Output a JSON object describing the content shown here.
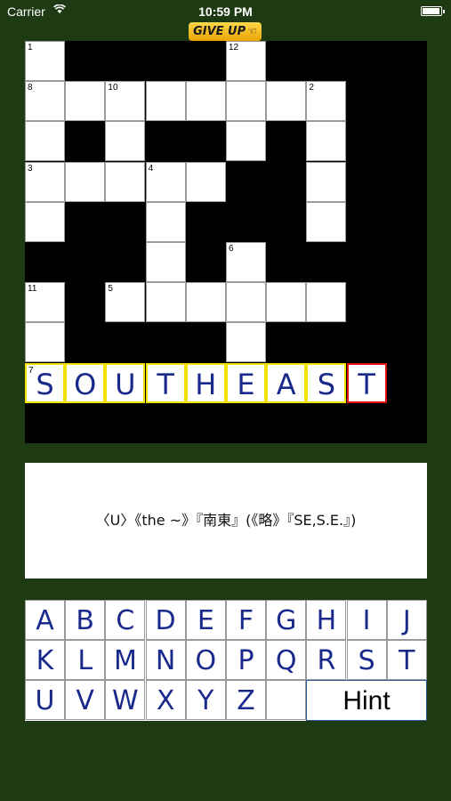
{
  "status": {
    "carrier": "Carrier",
    "time": "10:59 PM"
  },
  "header": {
    "give_up_label": "GIVE UP"
  },
  "board": {
    "cells": [
      {
        "r": 0,
        "c": 0,
        "num": "1"
      },
      {
        "r": 0,
        "c": 5,
        "num": "12"
      },
      {
        "r": 1,
        "c": 0,
        "num": "8"
      },
      {
        "r": 1,
        "c": 1
      },
      {
        "r": 1,
        "c": 2,
        "num": "10"
      },
      {
        "r": 1,
        "c": 3
      },
      {
        "r": 1,
        "c": 4
      },
      {
        "r": 1,
        "c": 5
      },
      {
        "r": 1,
        "c": 6
      },
      {
        "r": 1,
        "c": 7,
        "num": "2"
      },
      {
        "r": 2,
        "c": 0
      },
      {
        "r": 2,
        "c": 2
      },
      {
        "r": 2,
        "c": 5
      },
      {
        "r": 2,
        "c": 7
      },
      {
        "r": 3,
        "c": 0,
        "num": "3"
      },
      {
        "r": 3,
        "c": 1
      },
      {
        "r": 3,
        "c": 2
      },
      {
        "r": 3,
        "c": 3,
        "num": "4"
      },
      {
        "r": 3,
        "c": 4
      },
      {
        "r": 3,
        "c": 7
      },
      {
        "r": 4,
        "c": 0
      },
      {
        "r": 4,
        "c": 3
      },
      {
        "r": 4,
        "c": 7
      },
      {
        "r": 5,
        "c": 3
      },
      {
        "r": 5,
        "c": 5,
        "num": "6"
      },
      {
        "r": 6,
        "c": 0,
        "num": "11"
      },
      {
        "r": 6,
        "c": 2,
        "num": "5"
      },
      {
        "r": 6,
        "c": 3
      },
      {
        "r": 6,
        "c": 4
      },
      {
        "r": 6,
        "c": 5
      },
      {
        "r": 6,
        "c": 6
      },
      {
        "r": 6,
        "c": 7
      },
      {
        "r": 7,
        "c": 0
      },
      {
        "r": 7,
        "c": 5
      },
      {
        "r": 8,
        "c": 0,
        "num": "7",
        "letter": "S",
        "state": "active"
      },
      {
        "r": 8,
        "c": 1,
        "letter": "O",
        "state": "active"
      },
      {
        "r": 8,
        "c": 2,
        "letter": "U",
        "state": "active"
      },
      {
        "r": 8,
        "c": 3,
        "letter": "T",
        "state": "active"
      },
      {
        "r": 8,
        "c": 4,
        "letter": "H",
        "state": "active"
      },
      {
        "r": 8,
        "c": 5,
        "letter": "E",
        "state": "active"
      },
      {
        "r": 8,
        "c": 6,
        "letter": "A",
        "state": "active"
      },
      {
        "r": 8,
        "c": 7,
        "letter": "S",
        "state": "active"
      },
      {
        "r": 8,
        "c": 8,
        "letter": "T",
        "state": "current"
      }
    ]
  },
  "clue": {
    "text": "〈U〉《the ~》『南東』(《略》『SE,S.E.』)"
  },
  "keyboard": {
    "rows": [
      [
        "A",
        "B",
        "C",
        "D",
        "E",
        "F",
        "G",
        "H",
        "I",
        "J"
      ],
      [
        "K",
        "L",
        "M",
        "N",
        "O",
        "P",
        "Q",
        "R",
        "S",
        "T"
      ],
      [
        "U",
        "V",
        "W",
        "X",
        "Y",
        "Z"
      ]
    ],
    "hint_label": "Hint"
  },
  "colors": {
    "background": "#1e3a12",
    "letter": "#1a2a8c",
    "active_border": "#f2e200",
    "current_border": "#e01010",
    "give_up": "#f2b800"
  }
}
